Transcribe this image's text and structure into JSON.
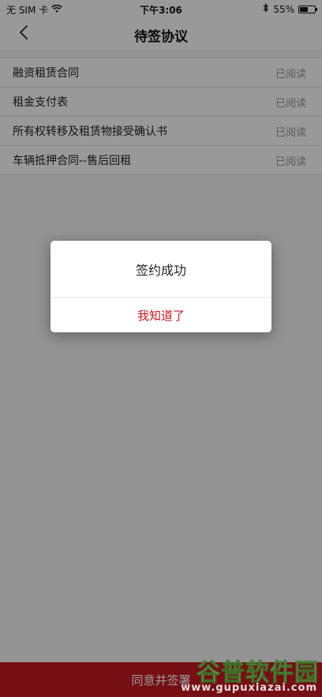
{
  "status_bar": {
    "carrier": "无 SIM 卡",
    "time": "下午3:06",
    "battery_percent_text": "55%",
    "battery_level": 0.55,
    "icons": [
      "wifi-icon",
      "bluetooth-icon",
      "battery-icon"
    ]
  },
  "nav": {
    "title": "待签协议",
    "back_icon": "chevron-left-icon"
  },
  "agreements": [
    {
      "title": "融资租赁合同",
      "status": "已阅读"
    },
    {
      "title": "租金支付表",
      "status": "已阅读"
    },
    {
      "title": "所有权转移及租赁物接受确认书",
      "status": "已阅读"
    },
    {
      "title": "车辆抵押合同--售后回租",
      "status": "已阅读"
    }
  ],
  "bottom_button": {
    "label": "同意并签署"
  },
  "dialog": {
    "message": "签约成功",
    "confirm_label": "我知道了"
  },
  "watermark": {
    "main": "谷普软件园",
    "sub": "www.gupuxiazai.com"
  },
  "colors": {
    "accent": "#c41a22",
    "muted_text": "#999999",
    "divider": "#e2e2e2"
  }
}
